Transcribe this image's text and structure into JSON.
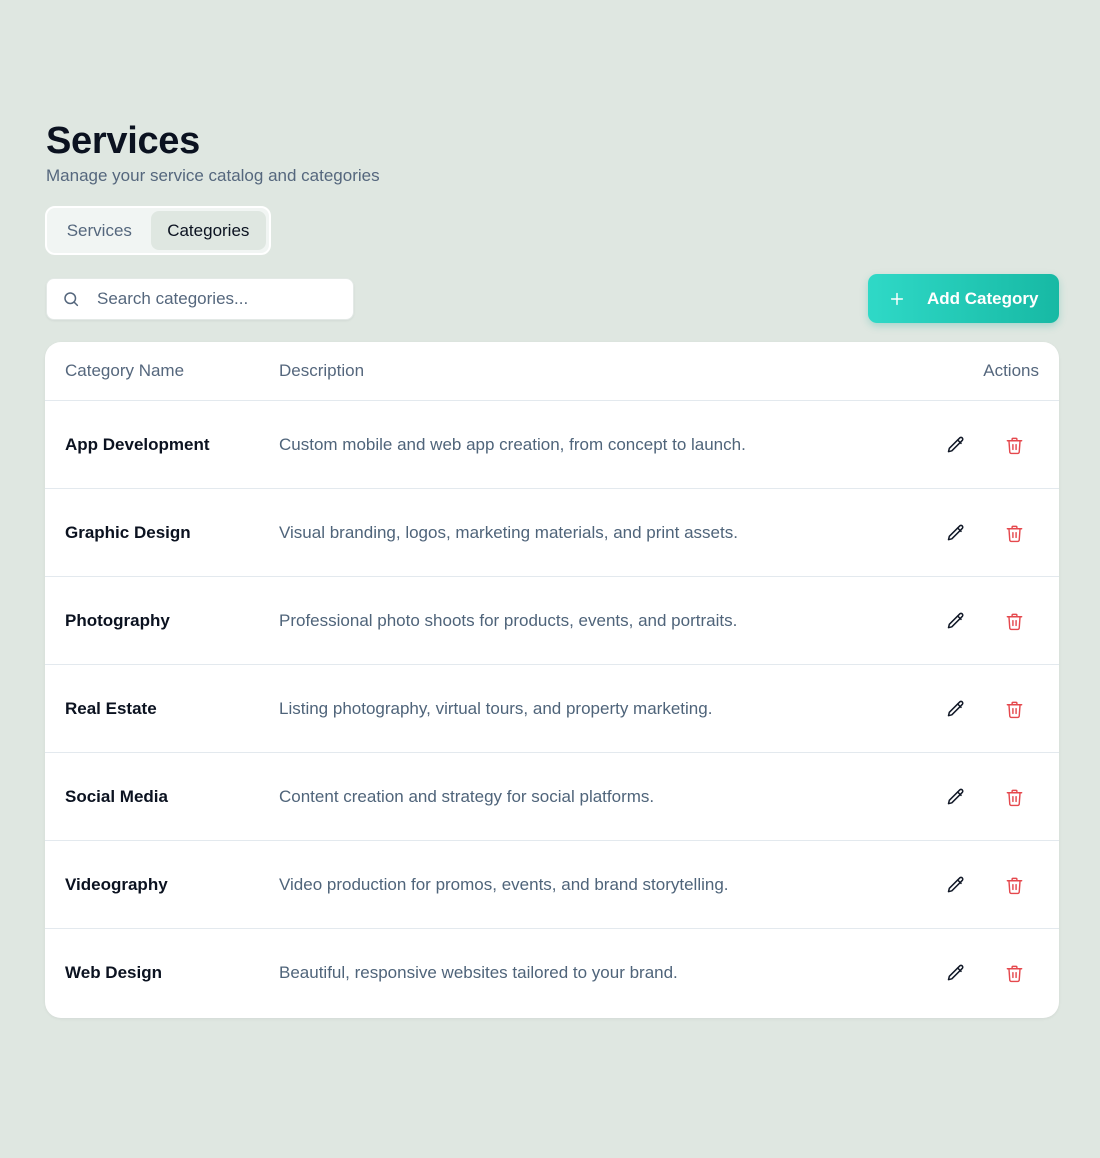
{
  "header": {
    "title": "Services",
    "subtitle": "Manage your service catalog and categories"
  },
  "tabs": [
    {
      "label": "Services",
      "active": false
    },
    {
      "label": "Categories",
      "active": true
    }
  ],
  "search": {
    "placeholder": "Search categories...",
    "value": "",
    "icon": "search-icon"
  },
  "add_button": {
    "label": "Add Category",
    "icon": "plus-icon"
  },
  "colors": {
    "background": "#dfe7e1",
    "accent_start": "#2fd9c7",
    "accent_end": "#17b9a4",
    "delete": "#e5484d",
    "heading": "#0b1220",
    "muted": "#55677d"
  },
  "table": {
    "columns": [
      "Category Name",
      "Description",
      "Actions"
    ],
    "rows": [
      {
        "name": "App Development",
        "description": "Custom mobile and web app creation, from concept to launch."
      },
      {
        "name": "Graphic Design",
        "description": "Visual branding, logos, marketing materials, and print assets."
      },
      {
        "name": "Photography",
        "description": "Professional photo shoots for products, events, and portraits."
      },
      {
        "name": "Real Estate",
        "description": "Listing photography, virtual tours, and property marketing."
      },
      {
        "name": "Social Media",
        "description": "Content creation and strategy for social platforms."
      },
      {
        "name": "Videography",
        "description": "Video production for promos, events, and brand storytelling."
      },
      {
        "name": "Web Design",
        "description": "Beautiful, responsive websites tailored to your brand."
      }
    ],
    "row_actions": {
      "edit_icon": "pencil-icon",
      "delete_icon": "trash-icon"
    }
  }
}
